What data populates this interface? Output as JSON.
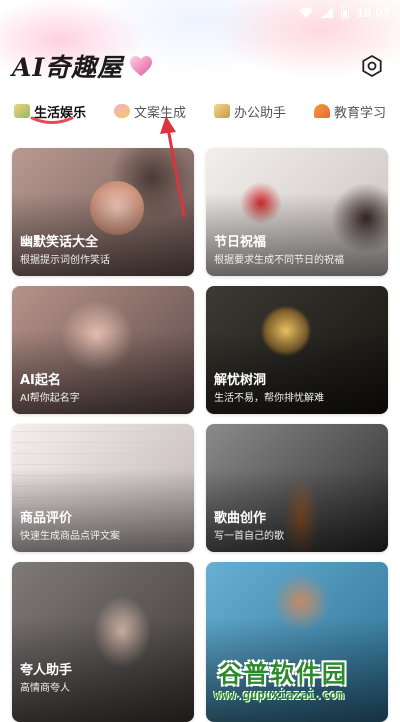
{
  "status_bar": {
    "time": "10:07"
  },
  "header": {
    "app_title": "AI奇趣屋"
  },
  "tabs": [
    {
      "label": "生活娱乐",
      "active": true,
      "icon": "book-icon"
    },
    {
      "label": "文案生成",
      "active": false,
      "icon": "candy-icon"
    },
    {
      "label": "办公助手",
      "active": false,
      "icon": "scroll-icon"
    },
    {
      "label": "教育学习",
      "active": false,
      "icon": "umbrella-icon"
    }
  ],
  "cards": [
    {
      "title": "幽默笑话大全",
      "subtitle": "根据提示词创作笑话"
    },
    {
      "title": "节日祝福",
      "subtitle": "根据要求生成不同节日的祝福"
    },
    {
      "title": "AI起名",
      "subtitle": "AI帮你起名字"
    },
    {
      "title": "解忧树洞",
      "subtitle": "生活不易，帮你排忧解难"
    },
    {
      "title": "商品评价",
      "subtitle": "快速生成商品点评文案"
    },
    {
      "title": "歌曲创作",
      "subtitle": "写一首自己的歌"
    },
    {
      "title": "夸人助手",
      "subtitle": "高情商夸人"
    },
    {
      "title": "",
      "subtitle": ""
    }
  ],
  "watermark": {
    "name": "谷普软件园",
    "url": "www.gupuxiazai.com"
  },
  "colors": {
    "accent": "#e8495a",
    "arrow": "#d9343f",
    "watermark": "#2b8a2b"
  }
}
